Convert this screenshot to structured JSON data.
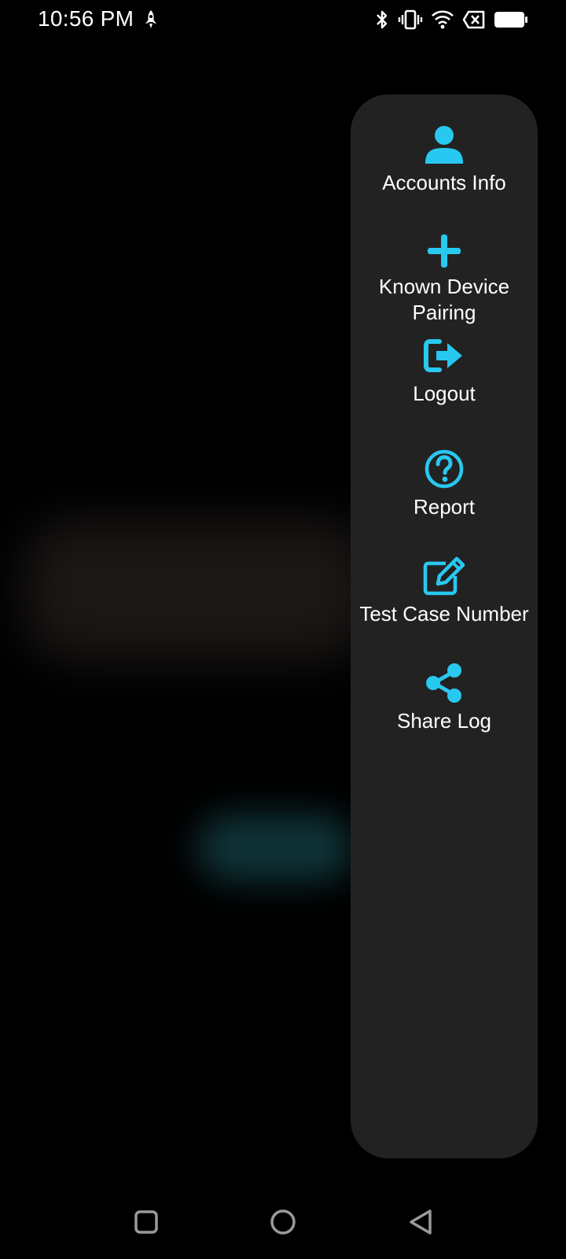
{
  "status_bar": {
    "time": "10:56 PM",
    "left_icons": [
      "rocket-icon"
    ],
    "right_icons": [
      "bluetooth-icon",
      "vibrate-icon",
      "wifi-icon",
      "no-sim-icon",
      "battery-icon"
    ]
  },
  "menu": {
    "items": [
      {
        "label": "Accounts Info",
        "icon": "person-icon"
      },
      {
        "label": "Known Device Pairing",
        "icon": "plus-icon"
      },
      {
        "label": "Logout",
        "icon": "logout-icon"
      },
      {
        "label": "Report",
        "icon": "question-circle-icon"
      },
      {
        "label": "Test Case Number",
        "icon": "edit-icon"
      },
      {
        "label": "Share Log",
        "icon": "share-icon"
      }
    ]
  },
  "nav_bar": {
    "buttons": [
      "recents-square-icon",
      "home-circle-icon",
      "back-triangle-icon"
    ]
  },
  "colors": {
    "accent": "#29C8F0",
    "panel": "#222222",
    "background": "#000000"
  }
}
